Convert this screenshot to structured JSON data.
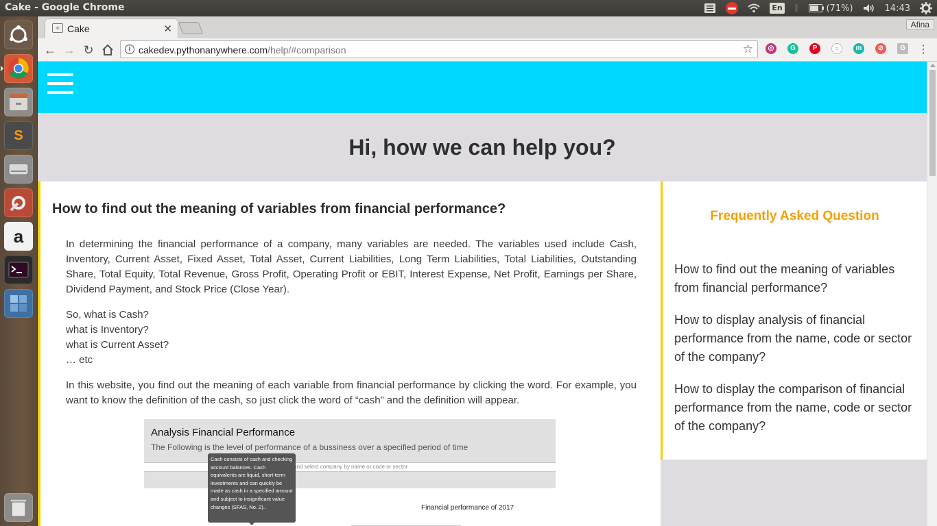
{
  "system": {
    "window_title": "Cake - Google Chrome",
    "battery": "(71%)",
    "time": "14:43",
    "keyboard_lang": "En"
  },
  "browser": {
    "tab_title": "Cake",
    "url_host": "cakedev.pythonanywhere.com",
    "url_path": "/help/#comparison",
    "profile_name": "Afina"
  },
  "page": {
    "hero_title": "Hi, how we can help you?",
    "article": {
      "heading": "How to find out the meaning of variables from financial performance?",
      "para1": "In determining the financial performance of a company, many variables are needed. The variables used include Cash, Inventory, Current Asset, Fixed Asset, Total Asset, Current Liabilities, Long Term Liabilities, Total Liabilities, Outstanding Share, Total Equity, Total Revenue, Gross Profit, Operating Profit or EBIT, Interest Expense, Net Profit, Earnings per Share, Dividend Payment, and Stock Price (Close Year).",
      "questions": [
        "So, what is Cash?",
        "what is Inventory?",
        "what is Current Asset?",
        "… etc"
      ],
      "para2": "In this website, you find out the meaning of each variable from financial performance by clicking the word. For example, you want to know the definition of the cash, so just click the word of “cash” and the definition will appear."
    },
    "example_image": {
      "title": "Analysis Financial Performance",
      "subtitle": "The Following is the level of performance of a bussiness over a specified period of time",
      "input_hint": "and select company by name or code or sector",
      "tooltip": "Cash consists of cash and checking account balances. Cash equivalents are liquid, short-term investments and can quickly be made as cash in a specified amount and subject to insignificant value changes (SFAS, No. 2)..",
      "chart_title": "Financial performance of 2017"
    },
    "faq": {
      "title": "Frequently Asked Question",
      "items": [
        "How to find out the meaning of variables from financial performance?",
        "How to display analysis of financial performance from the name, code or sector of the company?",
        "How to display the comparison of financial performance from the name, code or sector of the company?"
      ]
    }
  },
  "colors": {
    "header": "#00d7ff",
    "accent_border": "#f6d000",
    "faq_title": "#f5a000"
  }
}
